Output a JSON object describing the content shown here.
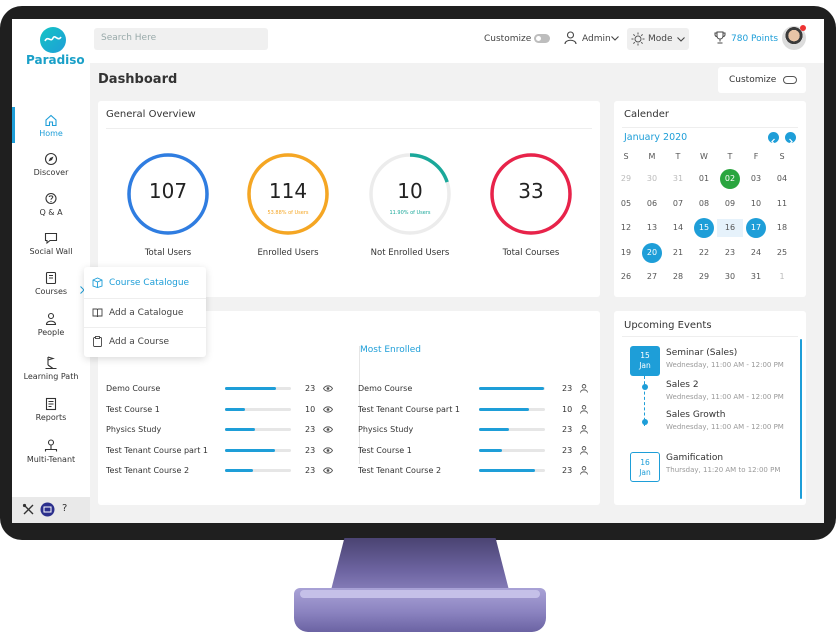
{
  "app": {
    "logo_text": "Paradiso"
  },
  "topbar": {
    "search_placeholder": "Search Here",
    "customize_label": "Customize",
    "user_label": "Admin",
    "mode_label": "Mode",
    "points_label": "780 Points"
  },
  "sidebar": {
    "items": [
      {
        "label": "Home",
        "icon": "home-icon"
      },
      {
        "label": "Discover",
        "icon": "compass-icon"
      },
      {
        "label": "Q & A",
        "icon": "qa-icon"
      },
      {
        "label": "Social Wall",
        "icon": "chat-icon"
      },
      {
        "label": "Courses",
        "icon": "book-icon"
      },
      {
        "label": "People",
        "icon": "people-icon"
      },
      {
        "label": "Learning Path",
        "icon": "path-icon"
      },
      {
        "label": "Reports",
        "icon": "report-icon"
      },
      {
        "label": "Multi-Tenant",
        "icon": "tenant-icon"
      }
    ]
  },
  "courses_menu": {
    "items": [
      "Course Catalogue",
      "Add a Catalogue",
      "Add a Course"
    ]
  },
  "dashboard": {
    "title": "Dashboard",
    "customize_label": "Customize"
  },
  "overview": {
    "title": "General Overview",
    "stats": [
      {
        "value": "107",
        "label": "Total Users",
        "sub": "",
        "color": "#2f7de1",
        "fraction": 1.0
      },
      {
        "value": "114",
        "label": "Enrolled Users",
        "sub": "53.88% of Users",
        "color": "#f5a623",
        "fraction": 1.0
      },
      {
        "value": "10",
        "label": "Not Enrolled Users",
        "sub": "11.90% of Users",
        "color": "#1aa89a",
        "fraction": 0.2
      },
      {
        "value": "33",
        "label": "Total Courses",
        "sub": "",
        "color": "#e8234a",
        "fraction": 1.0
      }
    ]
  },
  "courses_stats": {
    "left_rows": [
      {
        "name": "Demo Course",
        "progress": 0.78,
        "count": "23"
      },
      {
        "name": "Test Course 1",
        "progress": 0.3,
        "count": "10"
      },
      {
        "name": "Physics Study",
        "progress": 0.45,
        "count": "23"
      },
      {
        "name": "Test Tenant Course part 1",
        "progress": 0.75,
        "count": "23"
      },
      {
        "name": "Test Tenant Course 2",
        "progress": 0.42,
        "count": "23"
      }
    ],
    "right_title": "Most Enrolled",
    "right_rows": [
      {
        "name": "Demo Course",
        "progress": 0.98,
        "count": "23"
      },
      {
        "name": "Test Tenant Course part 1",
        "progress": 0.75,
        "count": "10"
      },
      {
        "name": "Physics Study",
        "progress": 0.45,
        "count": "23"
      },
      {
        "name": "Test Course 1",
        "progress": 0.35,
        "count": "23"
      },
      {
        "name": "Test Tenant Course 2",
        "progress": 0.85,
        "count": "23"
      }
    ]
  },
  "calendar": {
    "title": "Calender",
    "month": "January 2020",
    "weekdays": [
      "S",
      "M",
      "T",
      "W",
      "T",
      "F",
      "S"
    ],
    "weeks": [
      [
        "29",
        "30",
        "31",
        "01",
        "02",
        "03",
        "04"
      ],
      [
        "05",
        "06",
        "07",
        "08",
        "09",
        "10",
        "11"
      ],
      [
        "12",
        "13",
        "14",
        "15",
        "16",
        "17",
        "18"
      ],
      [
        "19",
        "20",
        "21",
        "22",
        "23",
        "24",
        "25"
      ],
      [
        "26",
        "27",
        "28",
        "29",
        "30",
        "31",
        "1"
      ]
    ]
  },
  "events": {
    "title": "Upcoming Events",
    "items": [
      {
        "day": "15",
        "month": "Jan",
        "title": "Seminar (Sales)",
        "time": "Wednesday, 11:00 AM - 12:00 PM"
      },
      {
        "title": "Sales 2",
        "time": "Wednesday, 11:00 AM - 12:00 PM"
      },
      {
        "title": "Sales Growth",
        "time": "Wednesday, 11:00 AM - 12:00 PM"
      },
      {
        "day": "16",
        "month": "Jan",
        "title": "Gamification",
        "time": "Thursday, 11:20 AM to 12:00 PM"
      }
    ]
  }
}
